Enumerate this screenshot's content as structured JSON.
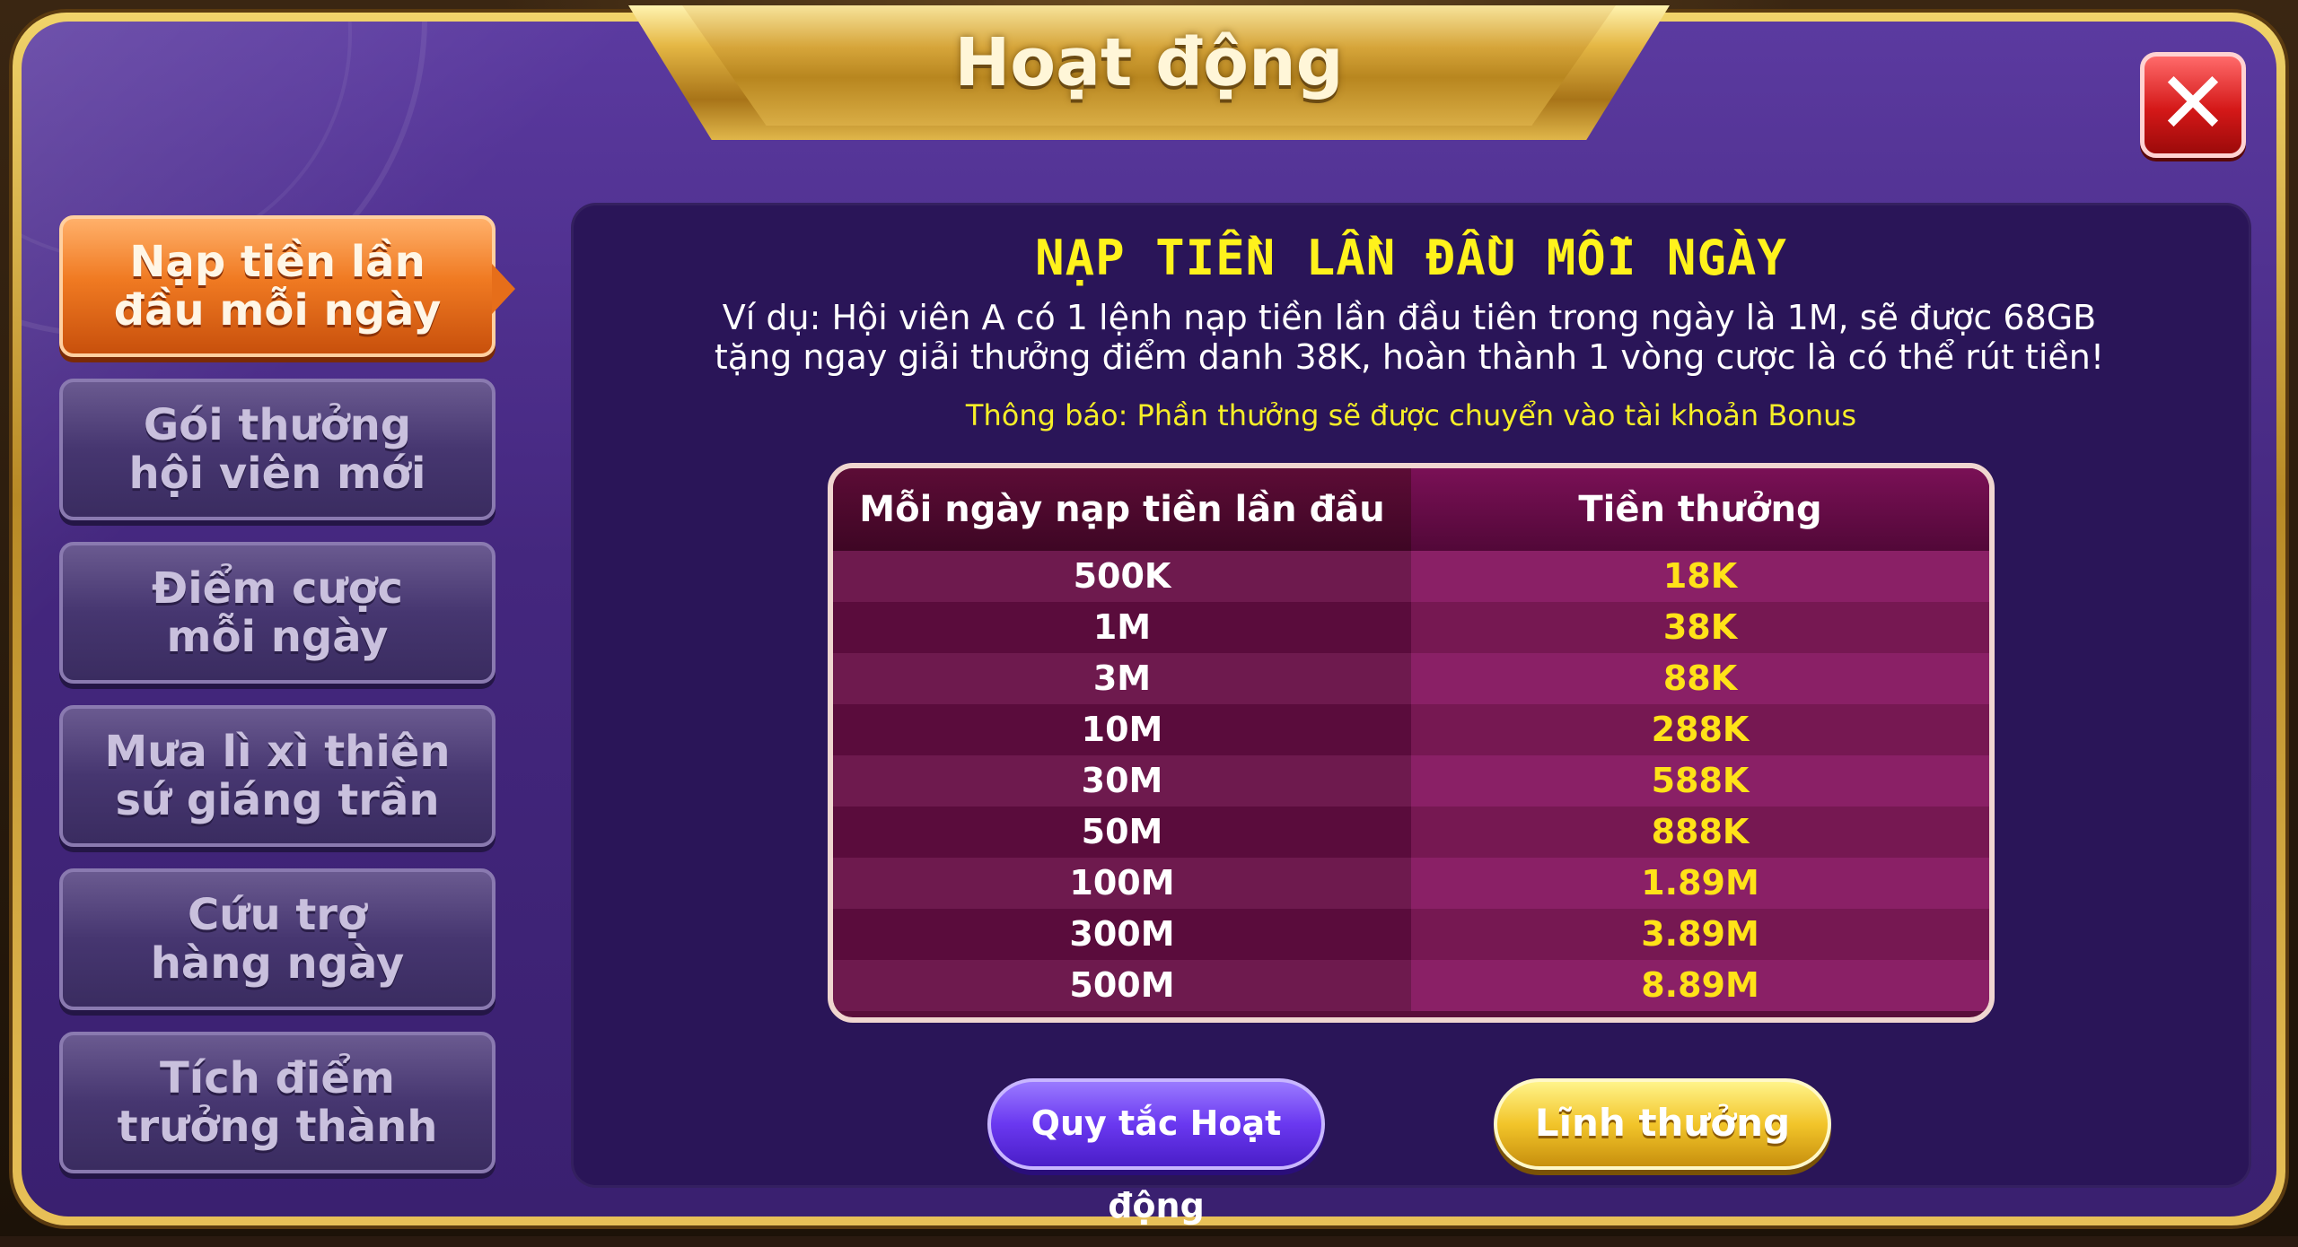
{
  "window": {
    "title": "Hoạt động",
    "close_glyph": "✕"
  },
  "sidebar": {
    "items": [
      {
        "label": "Nạp tiền lần\nđầu mỗi ngày",
        "active": true
      },
      {
        "label": "Gói thưởng\nhội viên mới",
        "active": false
      },
      {
        "label": "Điểm cược\nmỗi ngày",
        "active": false
      },
      {
        "label": "Mưa lì xì thiên\nsứ giáng trần",
        "active": false
      },
      {
        "label": "Cứu trợ\nhàng ngày",
        "active": false
      },
      {
        "label": "Tích điểm\ntrưởng thành",
        "active": false
      }
    ]
  },
  "content": {
    "heading": "NẠP TIỀN LẦN ĐẦU MỖI NGÀY",
    "description_line1": "Ví dụ: Hội viên A có 1 lệnh nạp tiền lần đầu tiên trong ngày là 1M, sẽ được 68GB",
    "description_line2": "tặng ngay giải thưởng điểm danh  38K, hoàn thành 1 vòng cược là có thể rút tiền!",
    "notice": "Thông báo: Phần thưởng sẽ được chuyển vào tài khoản Bonus"
  },
  "table": {
    "headers": [
      "Mỗi ngày nạp tiền lần đầu",
      "Tiền thưởng"
    ],
    "rows": [
      [
        "500K",
        "18K"
      ],
      [
        "1M",
        "38K"
      ],
      [
        "3M",
        "88K"
      ],
      [
        "10M",
        "288K"
      ],
      [
        "30M",
        "588K"
      ],
      [
        "50M",
        "888K"
      ],
      [
        "100M",
        "1.89M"
      ],
      [
        "300M",
        "3.89M"
      ],
      [
        "500M",
        "8.89M"
      ]
    ]
  },
  "buttons": {
    "rules_label": "Quy tắc Hoạt động",
    "claim_label": "Lĩnh thưởng"
  },
  "colors": {
    "panel_bg": "#2a1558",
    "heading": "#fff21c",
    "reward_value": "#ffe218",
    "active_tab": "#f07a22"
  },
  "icons": {
    "close": "close-icon"
  }
}
